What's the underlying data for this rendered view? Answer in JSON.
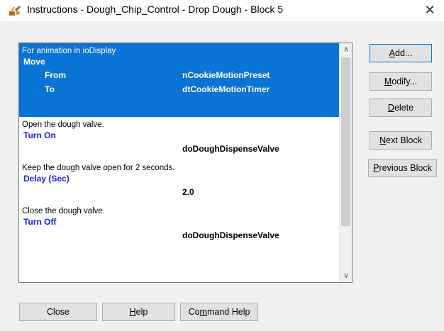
{
  "window": {
    "title": "Instructions - Dough_Chip_Control - Drop Dough - Block 5",
    "close_glyph": "✕",
    "icon": "tool-icon"
  },
  "instructions": [
    {
      "comment": "For animation in ioDisplay",
      "command": "Move",
      "selected": true,
      "params": [
        {
          "label": "From",
          "value": "nCookieMotionPreset"
        },
        {
          "label": "To",
          "value": "dtCookieMotionTimer"
        }
      ]
    },
    {
      "comment": "Open the dough valve.",
      "command": "Turn On",
      "selected": false,
      "params": [
        {
          "label": "",
          "value": "doDoughDispenseValve"
        }
      ]
    },
    {
      "comment": "Keep the dough valve open for 2 seconds.",
      "command": "Delay (Sec)",
      "selected": false,
      "params": [
        {
          "label": "",
          "value": "2.0"
        }
      ]
    },
    {
      "comment": "Close the dough valve.",
      "command": "Turn Off",
      "selected": false,
      "params": [
        {
          "label": "",
          "value": "doDoughDispenseValve"
        }
      ]
    }
  ],
  "buttons": {
    "add": {
      "pre": "",
      "key": "A",
      "post": "dd..."
    },
    "modify": {
      "pre": "",
      "key": "M",
      "post": "odify..."
    },
    "delete": {
      "pre": "",
      "key": "D",
      "post": "elete"
    },
    "next_block": {
      "pre": "",
      "key": "N",
      "post": "ext Block"
    },
    "previous_block": {
      "pre": "",
      "key": "P",
      "post": "revious Block"
    },
    "close": {
      "pre": "",
      "key": "",
      "post": "Close"
    },
    "help": {
      "pre": "",
      "key": "H",
      "post": "elp"
    },
    "command_help": {
      "pre": "Co",
      "key": "m",
      "post": "mand Help"
    }
  },
  "scrollbar": {
    "up_glyph": "∧",
    "down_glyph": "∨"
  },
  "colors": {
    "selection": "#0a74d6",
    "command_text": "#1a1aff"
  }
}
